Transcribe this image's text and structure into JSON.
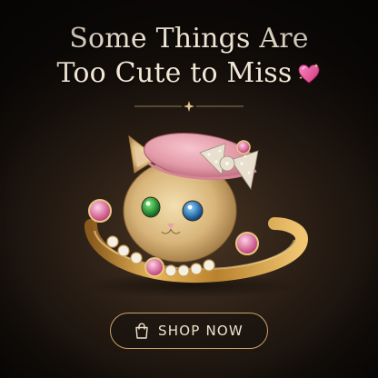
{
  "headline": {
    "line1": "Some Things Are",
    "line2": "Too Cute to Miss"
  },
  "heart_icon": "sparkling-heart-icon",
  "divider_icon": "sparkle-icon",
  "product_image": "gold-cat-ring-with-pink-beret",
  "cta": {
    "label": "SHOP NOW",
    "icon": "shopping-bag-icon"
  },
  "colors": {
    "background": "#1a130e",
    "headline_text": "#f1e7d6",
    "accent_gold": "#c9a36a",
    "beret_pink": "#e7a1ad"
  }
}
